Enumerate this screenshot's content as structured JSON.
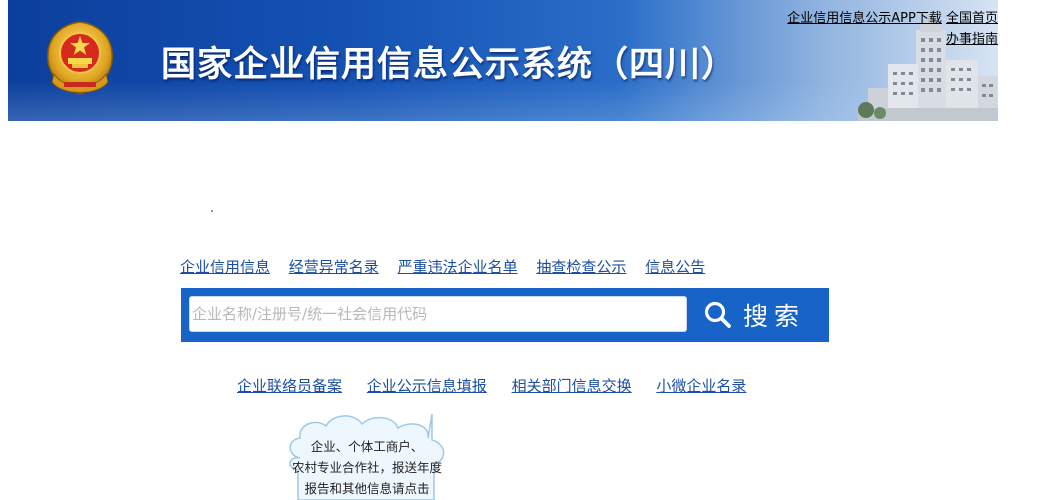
{
  "header": {
    "title": "国家企业信用信息公示系统（四川）",
    "top_links": {
      "app_download": "企业信用信息公示APP下载",
      "national_home": "全国首页",
      "guide": "办事指南"
    }
  },
  "category_nav": [
    "企业信用信息",
    "经营异常名录",
    "严重违法企业名单",
    "抽查检查公示",
    "信息公告"
  ],
  "search": {
    "placeholder": "企业名称/注册号/统一社会信用代码",
    "value": "",
    "button_label": "搜索",
    "icon": "search-icon"
  },
  "service_nav": [
    "企业联络员备案",
    "企业公示信息填报",
    "相关部门信息交换",
    "小微企业名录"
  ],
  "cloud_notice": {
    "line1": "企业、个体工商户、",
    "line2": "农村专业合作社，报送年度",
    "line3": "报告和其他信息请点击"
  },
  "colors": {
    "banner_blue": "#1552b4",
    "search_blue": "#1763c7",
    "link_blue": "#1c4fa3"
  }
}
